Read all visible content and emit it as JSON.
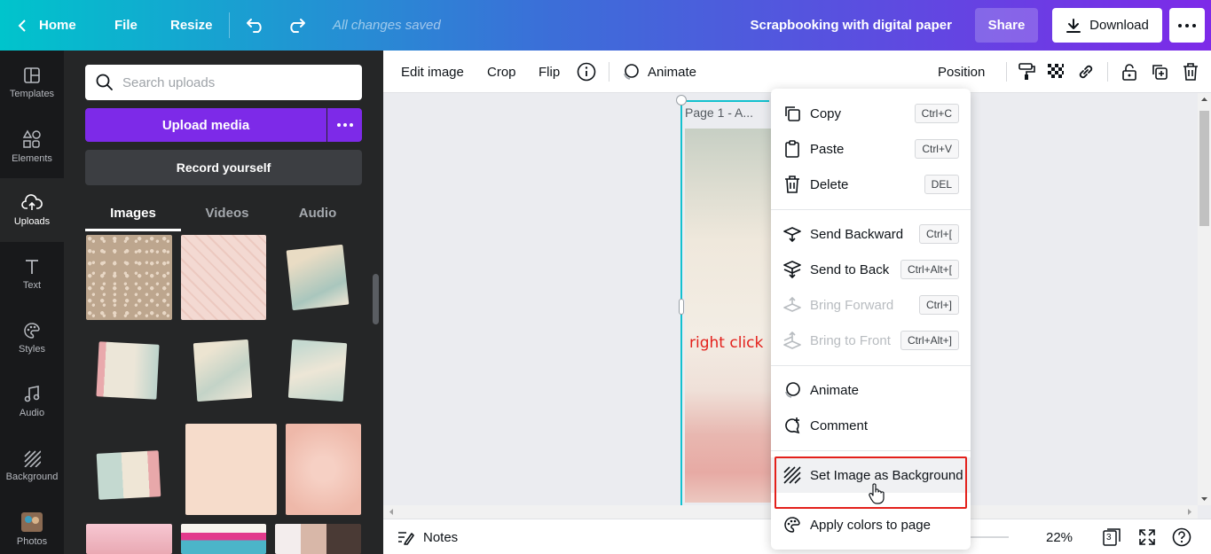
{
  "topbar": {
    "home": "Home",
    "file": "File",
    "resize": "Resize",
    "saved_status": "All changes saved",
    "doc_title": "Scrapbooking with digital paper",
    "share": "Share",
    "download": "Download",
    "colors": {
      "gradient_start": "#00c4cc",
      "gradient_end": "#7d2ae8"
    }
  },
  "rail": {
    "items": [
      {
        "label": "Templates",
        "icon": "templates-icon"
      },
      {
        "label": "Elements",
        "icon": "elements-icon"
      },
      {
        "label": "Uploads",
        "icon": "uploads-icon",
        "active": true
      },
      {
        "label": "Text",
        "icon": "text-icon"
      },
      {
        "label": "Styles",
        "icon": "styles-icon"
      },
      {
        "label": "Audio",
        "icon": "audio-icon"
      },
      {
        "label": "Background",
        "icon": "background-icon"
      },
      {
        "label": "Photos",
        "icon": "photos-icon"
      }
    ]
  },
  "panel": {
    "search_placeholder": "Search uploads",
    "upload_media": "Upload media",
    "record_yourself": "Record yourself",
    "tabs": [
      {
        "label": "Images",
        "active": true
      },
      {
        "label": "Videos"
      },
      {
        "label": "Audio"
      }
    ],
    "accent": "#7d2ae8"
  },
  "toolbar": {
    "edit_image": "Edit image",
    "crop": "Crop",
    "flip": "Flip",
    "animate": "Animate",
    "position": "Position"
  },
  "canvas": {
    "page_label": "Page 1 - A...",
    "annotation": "right click",
    "annotation_color": "#e3201b"
  },
  "bottombar": {
    "notes": "Notes",
    "zoom": "22%",
    "page_count": "3"
  },
  "context_menu": {
    "items": [
      {
        "label": "Copy",
        "shortcut": "Ctrl+C",
        "icon": "copy-icon"
      },
      {
        "label": "Paste",
        "shortcut": "Ctrl+V",
        "icon": "paste-icon"
      },
      {
        "label": "Delete",
        "shortcut": "DEL",
        "icon": "trash-icon"
      },
      {
        "label": "Send Backward",
        "shortcut": "Ctrl+[",
        "icon": "send-backward-icon"
      },
      {
        "label": "Send to Back",
        "shortcut": "Ctrl+Alt+[",
        "icon": "send-to-back-icon"
      },
      {
        "label": "Bring Forward",
        "shortcut": "Ctrl+]",
        "icon": "bring-forward-icon",
        "disabled": true
      },
      {
        "label": "Bring to Front",
        "shortcut": "Ctrl+Alt+]",
        "icon": "bring-to-front-icon",
        "disabled": true
      },
      {
        "label": "Animate",
        "icon": "animate-icon"
      },
      {
        "label": "Comment",
        "icon": "comment-icon"
      },
      {
        "label": "Set Image as Background",
        "icon": "background-icon",
        "highlighted": true
      },
      {
        "label": "Apply colors to page",
        "icon": "palette-icon"
      }
    ]
  }
}
